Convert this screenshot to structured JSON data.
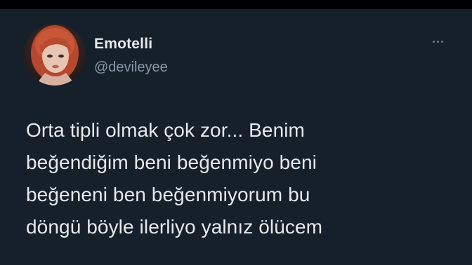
{
  "tweet": {
    "author": {
      "display_name": "Emotelli",
      "handle": "@devileyee",
      "avatar_icon": "profile-photo-red-haired-woman"
    },
    "more_icon": "ellipsis-icon",
    "text_lines": [
      "Orta tipli olmak çok zor... Benim",
      "beğendiğim beni beğenmiyo beni",
      "beğeneni ben beğenmiyorum bu",
      "döngü böyle ilerliyo yalnız ölücem"
    ]
  },
  "colors": {
    "background": "#15202b",
    "top_bar": "#000000",
    "primary_text": "#e7e9ea",
    "secondary_text": "#8b98a5"
  }
}
